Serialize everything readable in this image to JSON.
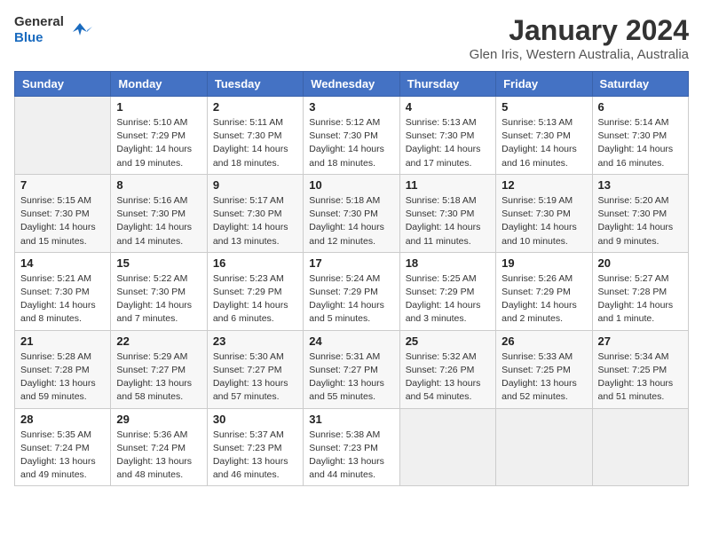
{
  "logo": {
    "line1": "General",
    "line2": "Blue"
  },
  "title": "January 2024",
  "subtitle": "Glen Iris, Western Australia, Australia",
  "days_of_week": [
    "Sunday",
    "Monday",
    "Tuesday",
    "Wednesday",
    "Thursday",
    "Friday",
    "Saturday"
  ],
  "weeks": [
    [
      {
        "num": "",
        "info": ""
      },
      {
        "num": "1",
        "info": "Sunrise: 5:10 AM\nSunset: 7:29 PM\nDaylight: 14 hours\nand 19 minutes."
      },
      {
        "num": "2",
        "info": "Sunrise: 5:11 AM\nSunset: 7:30 PM\nDaylight: 14 hours\nand 18 minutes."
      },
      {
        "num": "3",
        "info": "Sunrise: 5:12 AM\nSunset: 7:30 PM\nDaylight: 14 hours\nand 18 minutes."
      },
      {
        "num": "4",
        "info": "Sunrise: 5:13 AM\nSunset: 7:30 PM\nDaylight: 14 hours\nand 17 minutes."
      },
      {
        "num": "5",
        "info": "Sunrise: 5:13 AM\nSunset: 7:30 PM\nDaylight: 14 hours\nand 16 minutes."
      },
      {
        "num": "6",
        "info": "Sunrise: 5:14 AM\nSunset: 7:30 PM\nDaylight: 14 hours\nand 16 minutes."
      }
    ],
    [
      {
        "num": "7",
        "info": "Sunrise: 5:15 AM\nSunset: 7:30 PM\nDaylight: 14 hours\nand 15 minutes."
      },
      {
        "num": "8",
        "info": "Sunrise: 5:16 AM\nSunset: 7:30 PM\nDaylight: 14 hours\nand 14 minutes."
      },
      {
        "num": "9",
        "info": "Sunrise: 5:17 AM\nSunset: 7:30 PM\nDaylight: 14 hours\nand 13 minutes."
      },
      {
        "num": "10",
        "info": "Sunrise: 5:18 AM\nSunset: 7:30 PM\nDaylight: 14 hours\nand 12 minutes."
      },
      {
        "num": "11",
        "info": "Sunrise: 5:18 AM\nSunset: 7:30 PM\nDaylight: 14 hours\nand 11 minutes."
      },
      {
        "num": "12",
        "info": "Sunrise: 5:19 AM\nSunset: 7:30 PM\nDaylight: 14 hours\nand 10 minutes."
      },
      {
        "num": "13",
        "info": "Sunrise: 5:20 AM\nSunset: 7:30 PM\nDaylight: 14 hours\nand 9 minutes."
      }
    ],
    [
      {
        "num": "14",
        "info": "Sunrise: 5:21 AM\nSunset: 7:30 PM\nDaylight: 14 hours\nand 8 minutes."
      },
      {
        "num": "15",
        "info": "Sunrise: 5:22 AM\nSunset: 7:30 PM\nDaylight: 14 hours\nand 7 minutes."
      },
      {
        "num": "16",
        "info": "Sunrise: 5:23 AM\nSunset: 7:29 PM\nDaylight: 14 hours\nand 6 minutes."
      },
      {
        "num": "17",
        "info": "Sunrise: 5:24 AM\nSunset: 7:29 PM\nDaylight: 14 hours\nand 5 minutes."
      },
      {
        "num": "18",
        "info": "Sunrise: 5:25 AM\nSunset: 7:29 PM\nDaylight: 14 hours\nand 3 minutes."
      },
      {
        "num": "19",
        "info": "Sunrise: 5:26 AM\nSunset: 7:29 PM\nDaylight: 14 hours\nand 2 minutes."
      },
      {
        "num": "20",
        "info": "Sunrise: 5:27 AM\nSunset: 7:28 PM\nDaylight: 14 hours\nand 1 minute."
      }
    ],
    [
      {
        "num": "21",
        "info": "Sunrise: 5:28 AM\nSunset: 7:28 PM\nDaylight: 13 hours\nand 59 minutes."
      },
      {
        "num": "22",
        "info": "Sunrise: 5:29 AM\nSunset: 7:27 PM\nDaylight: 13 hours\nand 58 minutes."
      },
      {
        "num": "23",
        "info": "Sunrise: 5:30 AM\nSunset: 7:27 PM\nDaylight: 13 hours\nand 57 minutes."
      },
      {
        "num": "24",
        "info": "Sunrise: 5:31 AM\nSunset: 7:27 PM\nDaylight: 13 hours\nand 55 minutes."
      },
      {
        "num": "25",
        "info": "Sunrise: 5:32 AM\nSunset: 7:26 PM\nDaylight: 13 hours\nand 54 minutes."
      },
      {
        "num": "26",
        "info": "Sunrise: 5:33 AM\nSunset: 7:25 PM\nDaylight: 13 hours\nand 52 minutes."
      },
      {
        "num": "27",
        "info": "Sunrise: 5:34 AM\nSunset: 7:25 PM\nDaylight: 13 hours\nand 51 minutes."
      }
    ],
    [
      {
        "num": "28",
        "info": "Sunrise: 5:35 AM\nSunset: 7:24 PM\nDaylight: 13 hours\nand 49 minutes."
      },
      {
        "num": "29",
        "info": "Sunrise: 5:36 AM\nSunset: 7:24 PM\nDaylight: 13 hours\nand 48 minutes."
      },
      {
        "num": "30",
        "info": "Sunrise: 5:37 AM\nSunset: 7:23 PM\nDaylight: 13 hours\nand 46 minutes."
      },
      {
        "num": "31",
        "info": "Sunrise: 5:38 AM\nSunset: 7:23 PM\nDaylight: 13 hours\nand 44 minutes."
      },
      {
        "num": "",
        "info": ""
      },
      {
        "num": "",
        "info": ""
      },
      {
        "num": "",
        "info": ""
      }
    ]
  ]
}
